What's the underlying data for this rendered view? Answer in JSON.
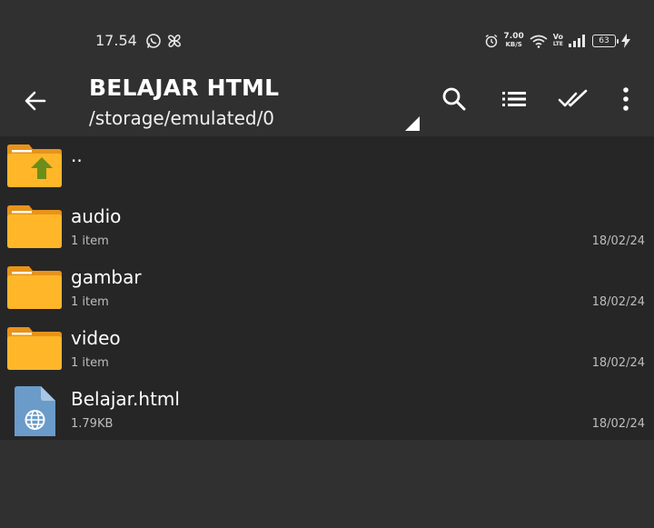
{
  "status_bar": {
    "time": "17.54",
    "notifications": [
      "whatsapp-icon",
      "pinwheel-icon"
    ],
    "net_speed_value": "7.00",
    "net_speed_unit": "KB/S",
    "volte_top": "Vo",
    "volte_bottom": "LTE",
    "battery": "63"
  },
  "toolbar": {
    "title": "BELAJAR HTML",
    "path": "/storage/emulated/0",
    "icons": [
      "back-arrow-icon",
      "search-icon",
      "list-view-icon",
      "select-all-icon",
      "more-vert-icon"
    ]
  },
  "files": [
    {
      "name": "..",
      "subtitle": "",
      "date": "",
      "type": "parent-folder"
    },
    {
      "name": "audio",
      "subtitle": "1 item",
      "date": "18/02/24",
      "type": "folder"
    },
    {
      "name": "gambar",
      "subtitle": "1 item",
      "date": "18/02/24",
      "type": "folder"
    },
    {
      "name": "video",
      "subtitle": "1 item",
      "date": "18/02/24",
      "type": "folder"
    },
    {
      "name": "Belajar.html",
      "subtitle": "1.79KB",
      "date": "18/02/24",
      "type": "html-file"
    }
  ],
  "colors": {
    "background": "#303030",
    "list_background": "#262626",
    "folder": "#f7a41d",
    "folder_light": "#ffc233",
    "up_arrow": "#6b8e1a",
    "html_file": "#6a9bc9"
  }
}
